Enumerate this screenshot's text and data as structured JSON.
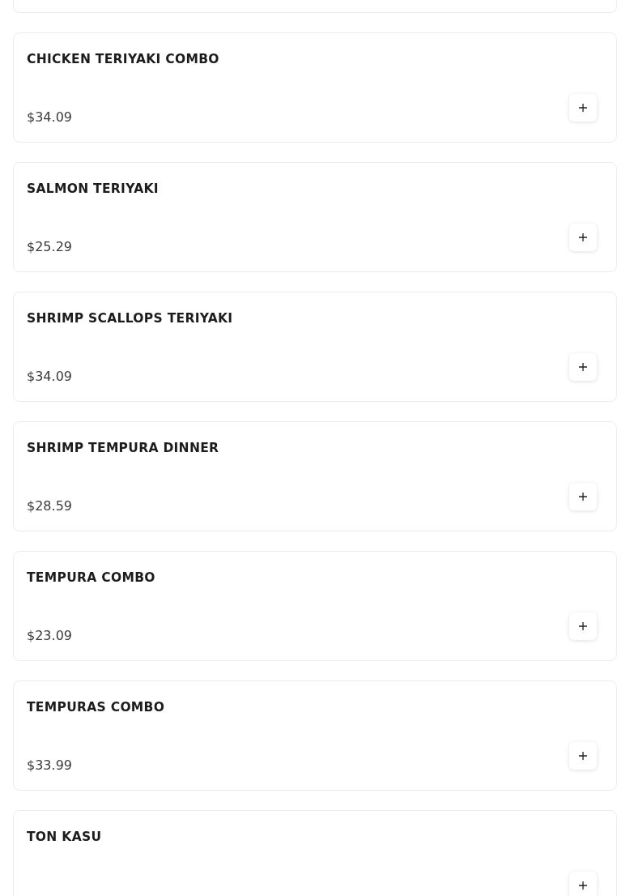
{
  "items": [
    {
      "name": "CHICKEN TERIYAKI COMBO",
      "price": "$34.09"
    },
    {
      "name": "SALMON TERIYAKI",
      "price": "$25.29"
    },
    {
      "name": "SHRIMP SCALLOPS TERIYAKI",
      "price": "$34.09"
    },
    {
      "name": "SHRIMP TEMPURA DINNER",
      "price": "$28.59"
    },
    {
      "name": "TEMPURA COMBO",
      "price": "$23.09"
    },
    {
      "name": "TEMPURAS COMBO",
      "price": "$33.99"
    },
    {
      "name": "TON KASU"
    }
  ]
}
